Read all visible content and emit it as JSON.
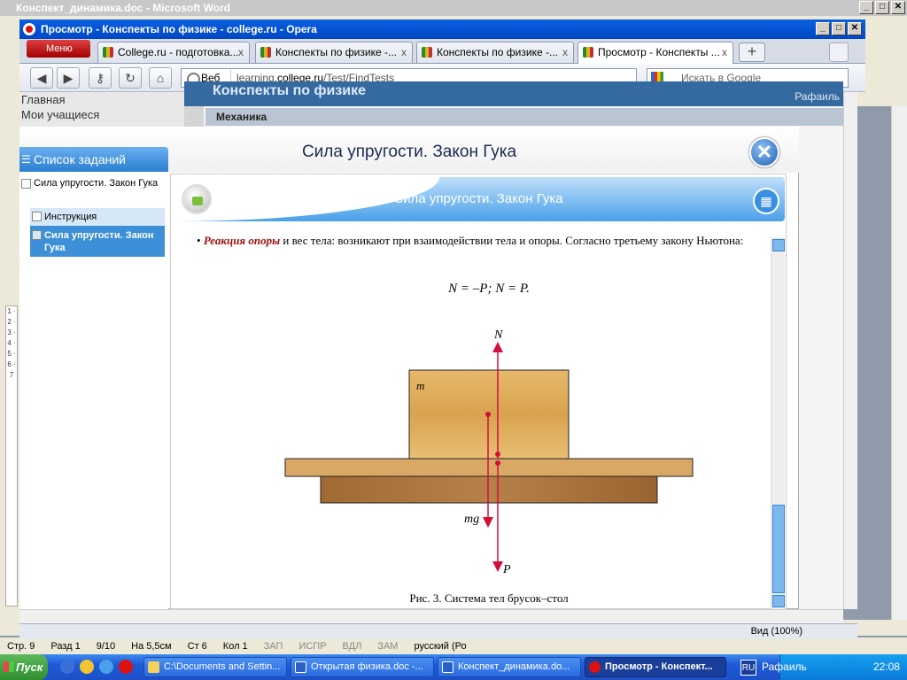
{
  "word": {
    "title": "Конспект_динамика.doc - Microsoft Word",
    "status": [
      "Стр. 9",
      "Разд 1",
      "9/10",
      "На 5,5см",
      "Ст 6",
      "Кол 1",
      "ЗАП",
      "ИСПР",
      "ВДЛ",
      "ЗАМ",
      "русский (Ро"
    ],
    "ruler_marks": "1 · 2 · 3 · 4 · 5 · 6 · 7"
  },
  "opera": {
    "title": "Просмотр - Конспекты по физике - college.ru - Opera",
    "menu_label": "Меню",
    "tabs": [
      {
        "label": "College.ru - подготовка..."
      },
      {
        "label": "Конспекты по физике -..."
      },
      {
        "label": "Конспекты по физике -..."
      },
      {
        "label": "Просмотр - Конспекты ..."
      }
    ],
    "address": {
      "scope": "Веб",
      "url_pre": "learning.",
      "url_host": "college.ru",
      "url_post": "/Test/FindTests"
    },
    "search_placeholder": "Искать в Google",
    "zoom": "Вид (100%)"
  },
  "site": {
    "header": "Конспекты по физике",
    "user": "Рафаиль",
    "nav": [
      "Главная",
      "Мои учащиеся"
    ],
    "section": "Механика"
  },
  "modal": {
    "title": "Сила упругости. Закон Гука",
    "close_glyph": "✕",
    "list_title": "Список заданий",
    "list_items": [
      {
        "label": "Сила упругости. Закон Гука"
      },
      {
        "label": "Инструкция"
      },
      {
        "label": "Сила упругости. Закон Гука"
      }
    ],
    "content_title": "Сила упругости. Закон Гука",
    "text_red": "Реакция опоры",
    "text_rest": " и вес тела: возникают при взаимодействии тела и опоры. Согласно третьему закону Ньютона:",
    "formula": "N = –P;  N = P.",
    "figure": {
      "label_N": "N",
      "label_mg": "mg",
      "label_P": "P",
      "label_m": "m"
    },
    "caption": "Рис. 3. Система тел брусок–стол"
  },
  "taskbar": {
    "start": "Пуск",
    "tasks": [
      {
        "label": "C:\\Documents and Settin..."
      },
      {
        "label": "Открытая физика.doc -..."
      },
      {
        "label": "Конспект_динамика.do..."
      },
      {
        "label": "Просмотр - Конспект..."
      }
    ],
    "lang": "RU",
    "user": "Рафаиль",
    "clock": "22:08"
  },
  "colors": {
    "accent": "#3d8fd8",
    "force_arrow": "#d0103a",
    "taskbar": "#1f5ad6"
  }
}
